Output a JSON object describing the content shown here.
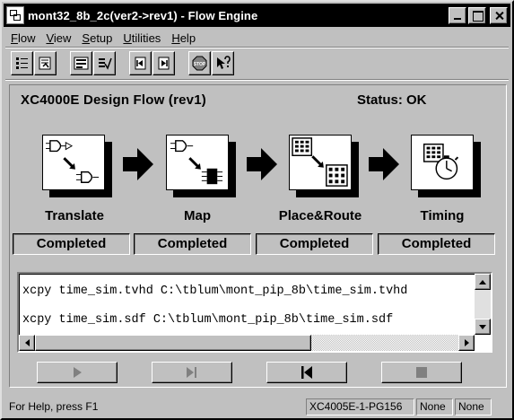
{
  "window": {
    "title": "mont32_8b_2c(ver2->rev1) - Flow Engine"
  },
  "menu": [
    {
      "accel": "F",
      "rest": "low"
    },
    {
      "accel": "V",
      "rest": "iew"
    },
    {
      "accel": "S",
      "rest": "etup"
    },
    {
      "accel": "U",
      "rest": "tilities"
    },
    {
      "accel": "H",
      "rest": "elp"
    }
  ],
  "toolbar": {
    "icons": [
      "flow-run-icon",
      "flow-options-icon",
      "report-icon",
      "report-check-icon",
      "step-back-icon",
      "step-forward-icon",
      "stop-icon",
      "context-help-icon"
    ],
    "stop_label": "STOP"
  },
  "flow": {
    "title": "XC4000E Design Flow (rev1)",
    "status": "Status: OK",
    "stages": [
      {
        "label": "Translate",
        "state": "Completed"
      },
      {
        "label": "Map",
        "state": "Completed"
      },
      {
        "label": "Place&Route",
        "state": "Completed"
      },
      {
        "label": "Timing",
        "state": "Completed"
      }
    ]
  },
  "log": {
    "lines": [
      "xcpy time_sim.tvhd C:\\tblum\\mont_pip_8b\\time_sim.tvhd",
      "xcpy time_sim.sdf C:\\tblum\\mont_pip_8b\\time_sim.sdf"
    ]
  },
  "statusbar": {
    "help": "For Help, press F1",
    "device": "XC4005E-1-PG156",
    "pane2": "None",
    "pane3": "None"
  }
}
